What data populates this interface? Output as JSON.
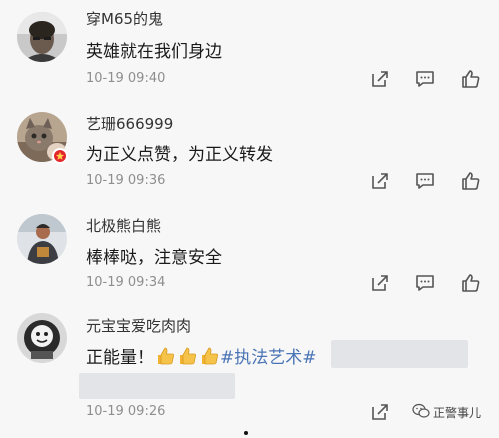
{
  "comments": [
    {
      "username": "穿M65的鬼",
      "content": "英雄就在我们身边",
      "time": "10-19 09:40",
      "avatar": "man-portrait-icon"
    },
    {
      "username": "艺珊666999",
      "content": "为正义点赞，为正义转发",
      "time": "10-19 09:36",
      "avatar": "cat-portrait-icon",
      "badge": "vip-badge"
    },
    {
      "username": "北极熊白熊",
      "content": "棒棒哒，注意安全",
      "time": "10-19 09:34",
      "avatar": "person-portrait-icon"
    },
    {
      "username": "元宝宝爱吃肉肉",
      "content_text": "正能量！",
      "content_emoji": "thumbs-up-emoji x3",
      "content_hashtag": "#执法艺术#",
      "time": "10-19 09:26",
      "avatar": "bw-character-icon"
    }
  ],
  "actions": {
    "repost": "share-icon",
    "comment": "comment-icon",
    "like": "thumbs-up-icon"
  },
  "watermark": {
    "text": "正警事儿",
    "icon": "wechat-icon"
  },
  "colors": {
    "background": "#f7f7f7",
    "hashtag": "#4a74b5",
    "time": "#8e8e8e",
    "badge": "#e2272d"
  }
}
